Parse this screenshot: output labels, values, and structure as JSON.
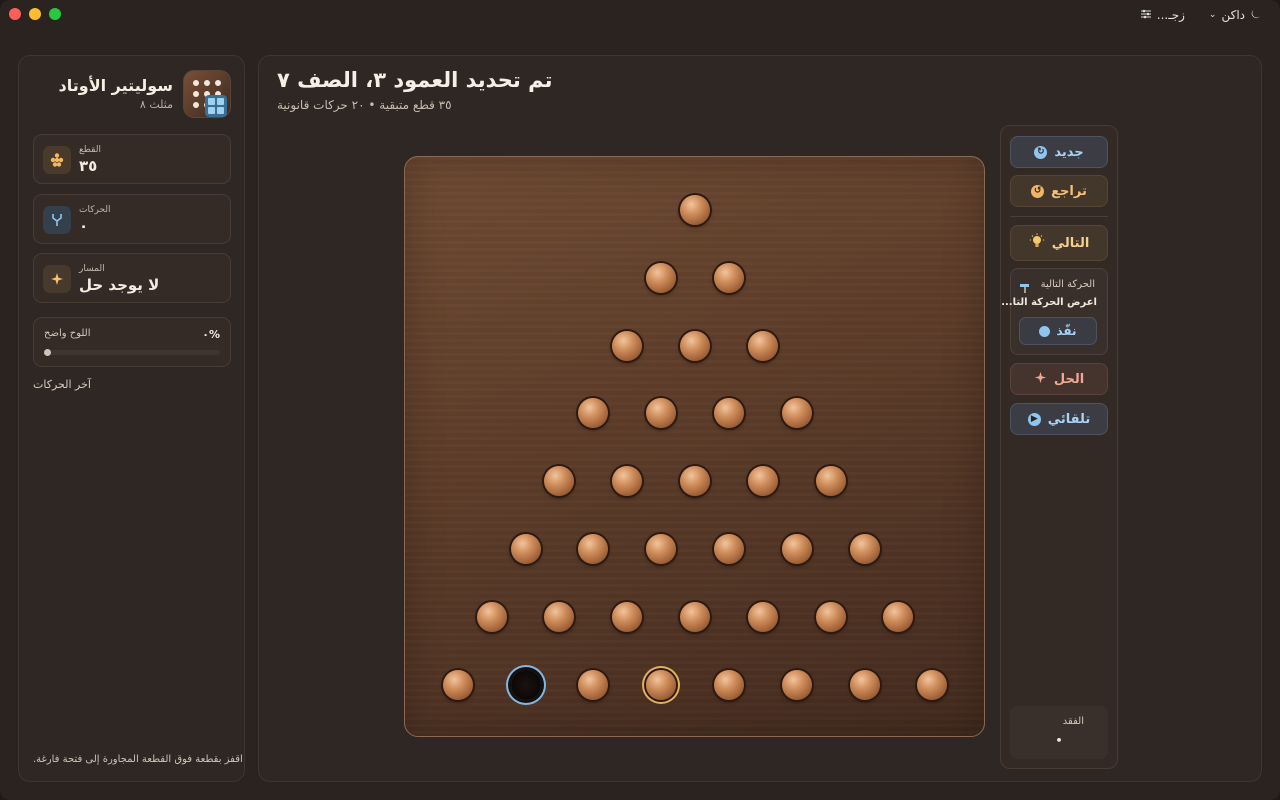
{
  "titlebar": {
    "theme_label": "داكن",
    "glass_label": "زجـ..."
  },
  "sidebar": {
    "app_title": "سوليتير الأوتاد",
    "app_subtitle": "مثلث ٨",
    "stats": {
      "pieces": {
        "label": "القطع",
        "value": "٣٥"
      },
      "moves": {
        "label": "الحركات",
        "value": "٠"
      },
      "path": {
        "label": "المسار",
        "value": "لا يوجد حل"
      }
    },
    "progress": {
      "label": "اللوح واضح",
      "percent_text": "٠%",
      "fraction": 0
    },
    "recent_moves_title": "آخر الحركات",
    "hint": "اقفز بقطعة فوق القطعة المجاورة إلى فتحة فارغة."
  },
  "main": {
    "title": "تم تحديد العمود ٣، الصف ٧",
    "subtitle": "٣٥ قطع متبقية • ٢٠ حركات قانونية"
  },
  "board": {
    "rows": 8,
    "empty": [
      [
        7,
        1
      ]
    ],
    "selected": [
      [
        7,
        3
      ]
    ]
  },
  "controls": {
    "new_label": "جديد",
    "undo_label": "تراجع",
    "next_label": "التالي",
    "next_move": {
      "title": "الحركة التالية",
      "text": "اعرض الحركة التا...",
      "execute_label": "نفّذ"
    },
    "solve_label": "الحل",
    "auto_label": "تلقائي",
    "loss": {
      "label": "الفقد",
      "value": "•"
    }
  },
  "colors": {
    "accent_blue": "#8ec6f0",
    "accent_amber": "#f0b567",
    "selected_ring": "#e1b35a",
    "empty_ring": "#7fb9e6"
  }
}
